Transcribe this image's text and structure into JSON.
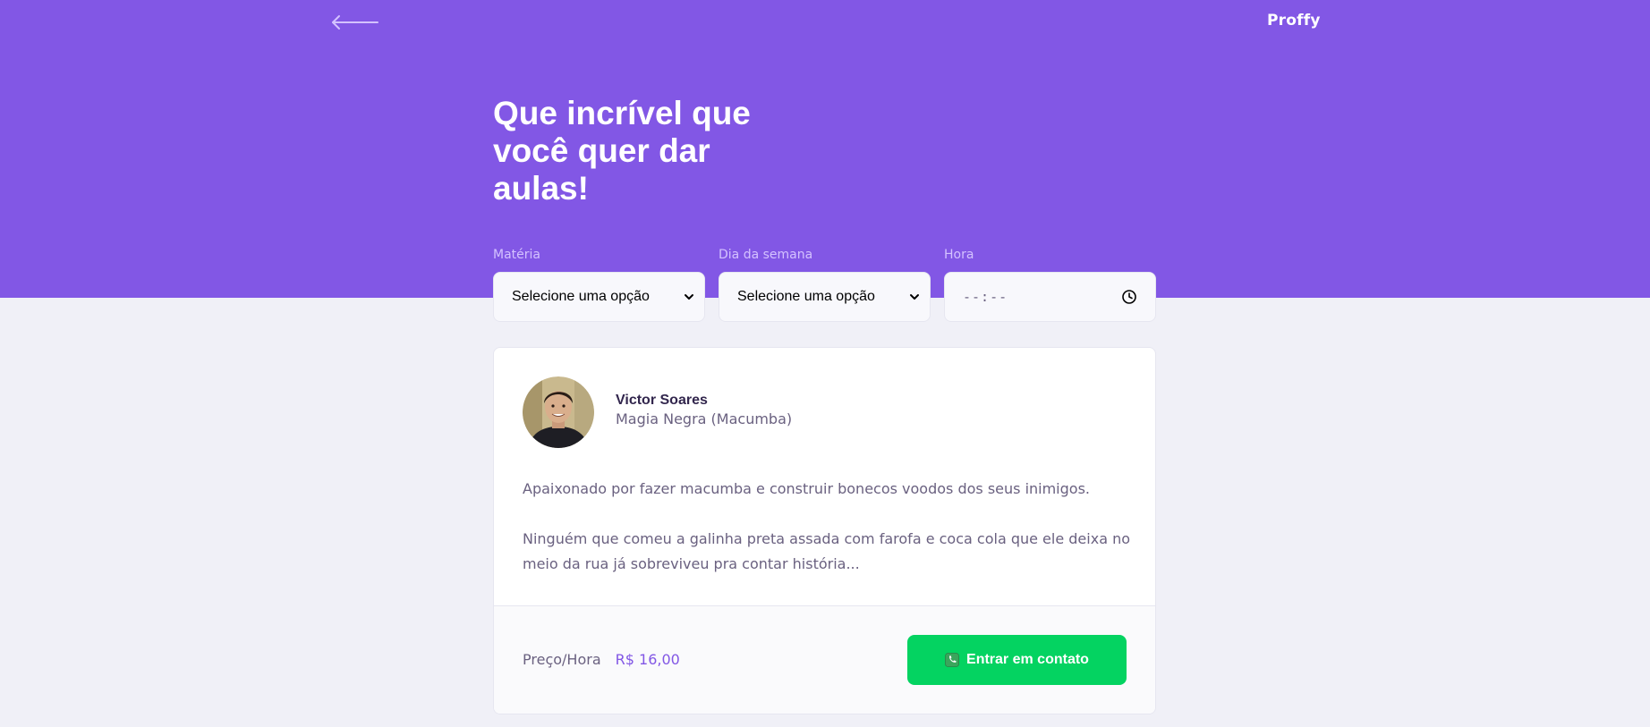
{
  "header": {
    "logo": "Proffy",
    "title": "Que incrível que você quer dar aulas!"
  },
  "filters": [
    {
      "label": "Matéria",
      "value": "Selecione uma opção",
      "icon": "chevron-down-icon"
    },
    {
      "label": "Dia da semana",
      "value": "Selecione uma opção",
      "icon": "chevron-down-icon"
    },
    {
      "label": "Hora",
      "value": "--:--",
      "icon": "clock-icon"
    }
  ],
  "teacher": {
    "name": "Victor Soares",
    "subject": "Magia Negra (Macumba)",
    "bio": [
      "Apaixonado por fazer macumba e construir bonecos voodos dos seus inimigos.",
      "Ninguém que comeu a galinha preta assada com farofa e coca cola que ele deixa no meio da rua já sobreviveu pra contar história..."
    ],
    "price_label": "Preço/Hora",
    "price_value": "R$ 16,00",
    "contact_label": "Entrar em contato"
  },
  "colors": {
    "primary": "#8257E5",
    "background": "#F0F0F7",
    "secondary": "#04D361",
    "text_title": "#32264D",
    "text_base": "#6A6180",
    "label": "#D4C2FF"
  }
}
